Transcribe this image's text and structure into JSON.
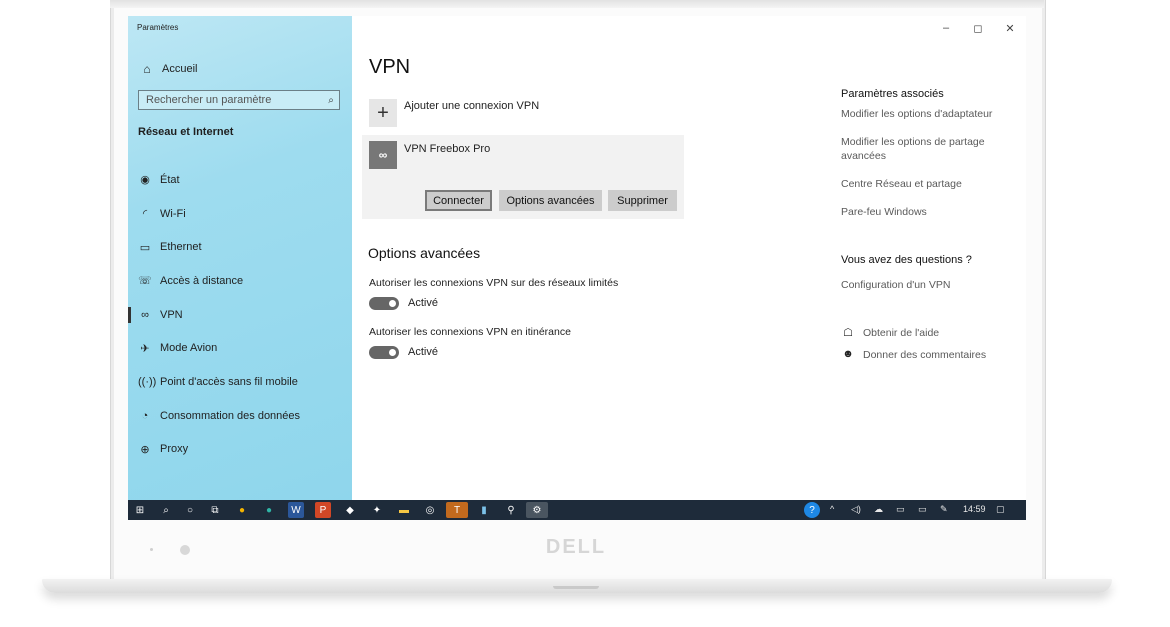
{
  "device": {
    "brand": "DELL"
  },
  "window": {
    "app_title": "Paramètres",
    "controls": {
      "minimize": "–",
      "restore": "◻",
      "close": "✕"
    }
  },
  "sidebar": {
    "home_label": "Accueil",
    "search_placeholder": "Rechercher un paramètre",
    "section_title": "Réseau et Internet",
    "items": [
      {
        "label": "État",
        "icon": "globe-icon"
      },
      {
        "label": "Wi-Fi",
        "icon": "wifi-icon"
      },
      {
        "label": "Ethernet",
        "icon": "ethernet-icon"
      },
      {
        "label": "Accès à distance",
        "icon": "dialup-icon"
      },
      {
        "label": "VPN",
        "icon": "vpn-icon",
        "active": true
      },
      {
        "label": "Mode Avion",
        "icon": "airplane-icon"
      },
      {
        "label": "Point d'accès sans fil mobile",
        "icon": "hotspot-icon"
      },
      {
        "label": "Consommation des données",
        "icon": "data-usage-icon"
      },
      {
        "label": "Proxy",
        "icon": "proxy-icon"
      }
    ]
  },
  "main": {
    "title": "VPN",
    "add_connection_label": "Ajouter une connexion VPN",
    "vpn_connection": {
      "name": "VPN Freebox Pro",
      "buttons": {
        "connect": "Connecter",
        "advanced": "Options avancées",
        "remove": "Supprimer"
      }
    },
    "advanced_title": "Options avancées",
    "options": [
      {
        "label": "Autoriser les connexions VPN sur des réseaux limités",
        "state": "Activé",
        "on": true
      },
      {
        "label": "Autoriser les connexions VPN en itinérance",
        "state": "Activé",
        "on": true
      }
    ]
  },
  "related": {
    "heading": "Paramètres associés",
    "links": [
      "Modifier les options d'adaptateur",
      "Modifier les options de partage avancées",
      "Centre Réseau et partage",
      "Pare-feu Windows"
    ],
    "questions_heading": "Vous avez des questions ?",
    "questions_link": "Configuration d'un VPN",
    "help_label": "Obtenir de l'aide",
    "feedback_label": "Donner des commentaires"
  },
  "taskbar": {
    "clock": "14:59",
    "accent_color": "#1e2b3a"
  }
}
